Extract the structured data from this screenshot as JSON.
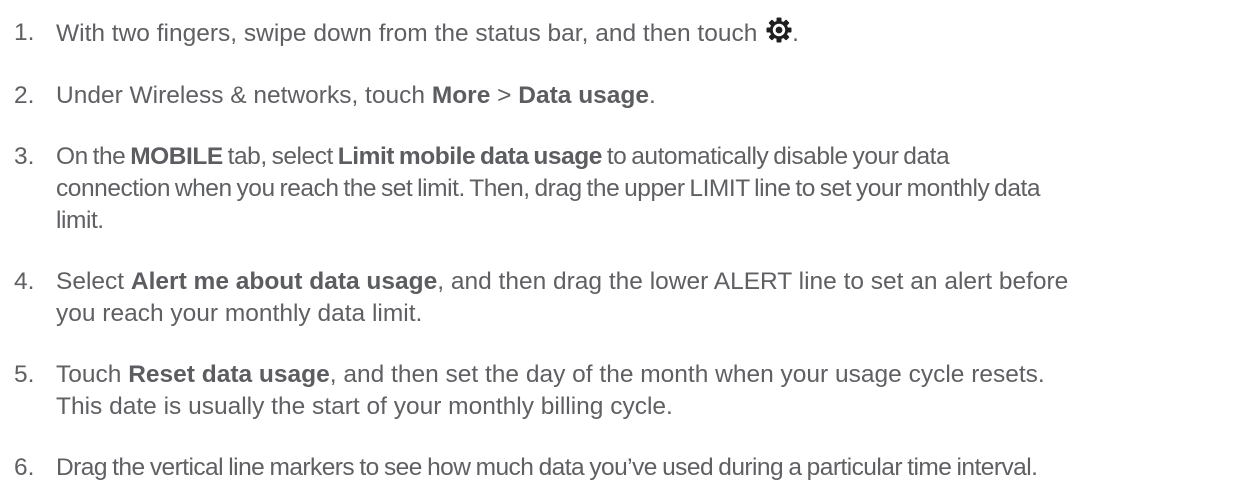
{
  "steps": [
    {
      "num": "1.",
      "parts": {
        "a": "With two fingers, swipe down from the status bar, and then touch ",
        "b": "."
      },
      "icon": "gear-icon"
    },
    {
      "num": "2.",
      "parts": {
        "a": "Under Wireless & networks, touch ",
        "b1": "More",
        "c": " > ",
        "b2": "Data usage",
        "d": "."
      }
    },
    {
      "num": "3.",
      "parts": {
        "a": "On the ",
        "b1": "MOBILE",
        "c": " tab, select ",
        "b2": "Limit mobile data usage",
        "d": " to automatically disable your data",
        "line2": "connection when you reach the set limit. Then, drag the upper LIMIT line to set your monthly data",
        "line3": "limit."
      }
    },
    {
      "num": "4.",
      "parts": {
        "a": "Select ",
        "b1": "Alert me about data usage",
        "c": ", and then drag the lower ALERT line to set an alert before",
        "line2": "you reach your monthly data limit."
      }
    },
    {
      "num": "5.",
      "parts": {
        "a": "Touch ",
        "b1": "Reset data usage",
        "c": ", and then set the day of the month when your usage cycle resets.",
        "line2": "This date is usually the start of your monthly billing cycle."
      }
    },
    {
      "num": "6.",
      "parts": {
        "a": "Drag the vertical line markers to see how much data you’ve used during a particular time interval."
      }
    }
  ],
  "colors": {
    "text": "#5f6063",
    "icon": "#1f1f1f"
  }
}
